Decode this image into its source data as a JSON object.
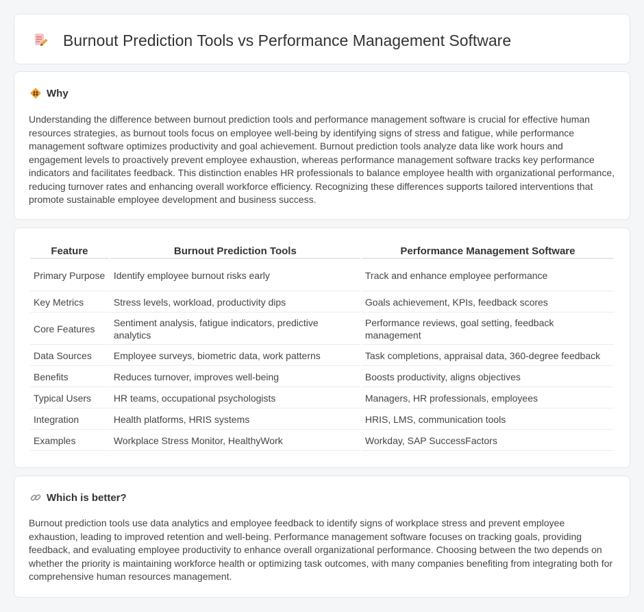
{
  "header": {
    "title": "Burnout Prediction Tools vs Performance Management Software",
    "icon": "document-pencil-icon"
  },
  "why": {
    "heading": "Why",
    "icon": "diamond-people-icon",
    "body": "Understanding the difference between burnout prediction tools and performance management software is crucial for effective human resources strategies, as burnout tools focus on employee well-being by identifying signs of stress and fatigue, while performance management software optimizes productivity and goal achievement. Burnout prediction tools analyze data like work hours and engagement levels to proactively prevent employee exhaustion, whereas performance management software tracks key performance indicators and facilitates feedback. This distinction enables HR professionals to balance employee health with organizational performance, reducing turnover rates and enhancing overall workforce efficiency. Recognizing these differences supports tailored interventions that promote sustainable employee development and business success."
  },
  "table": {
    "headers": [
      "Feature",
      "Burnout Prediction Tools",
      "Performance Management Software"
    ],
    "rows": [
      [
        "Primary Purpose",
        "Identify employee burnout risks early",
        "Track and enhance employee performance"
      ],
      [
        "Key Metrics",
        "Stress levels, workload, productivity dips",
        "Goals achievement, KPIs, feedback scores"
      ],
      [
        "Core Features",
        "Sentiment analysis, fatigue indicators, predictive analytics",
        "Performance reviews, goal setting, feedback management"
      ],
      [
        "Data Sources",
        "Employee surveys, biometric data, work patterns",
        "Task completions, appraisal data, 360-degree feedback"
      ],
      [
        "Benefits",
        "Reduces turnover, improves well-being",
        "Boosts productivity, aligns objectives"
      ],
      [
        "Typical Users",
        "HR teams, occupational psychologists",
        "Managers, HR professionals, employees"
      ],
      [
        "Integration",
        "Health platforms, HRIS systems",
        "HRIS, LMS, communication tools"
      ],
      [
        "Examples",
        "Workplace Stress Monitor, HealthyWork",
        "Workday, SAP SuccessFactors"
      ]
    ]
  },
  "which": {
    "heading": "Which is better?",
    "icon": "link-icon",
    "body": "Burnout prediction tools use data analytics and employee feedback to identify signs of workplace stress and prevent employee exhaustion, leading to improved retention and well-being. Performance management software focuses on tracking goals, providing feedback, and evaluating employee productivity to enhance overall organizational performance. Choosing between the two depends on whether the priority is maintaining workforce health or optimizing task outcomes, with many companies benefiting from integrating both for comprehensive human resources management."
  },
  "colors": {
    "background": "#f5f6f8",
    "card": "#ffffff",
    "accent": "#f0a030"
  }
}
